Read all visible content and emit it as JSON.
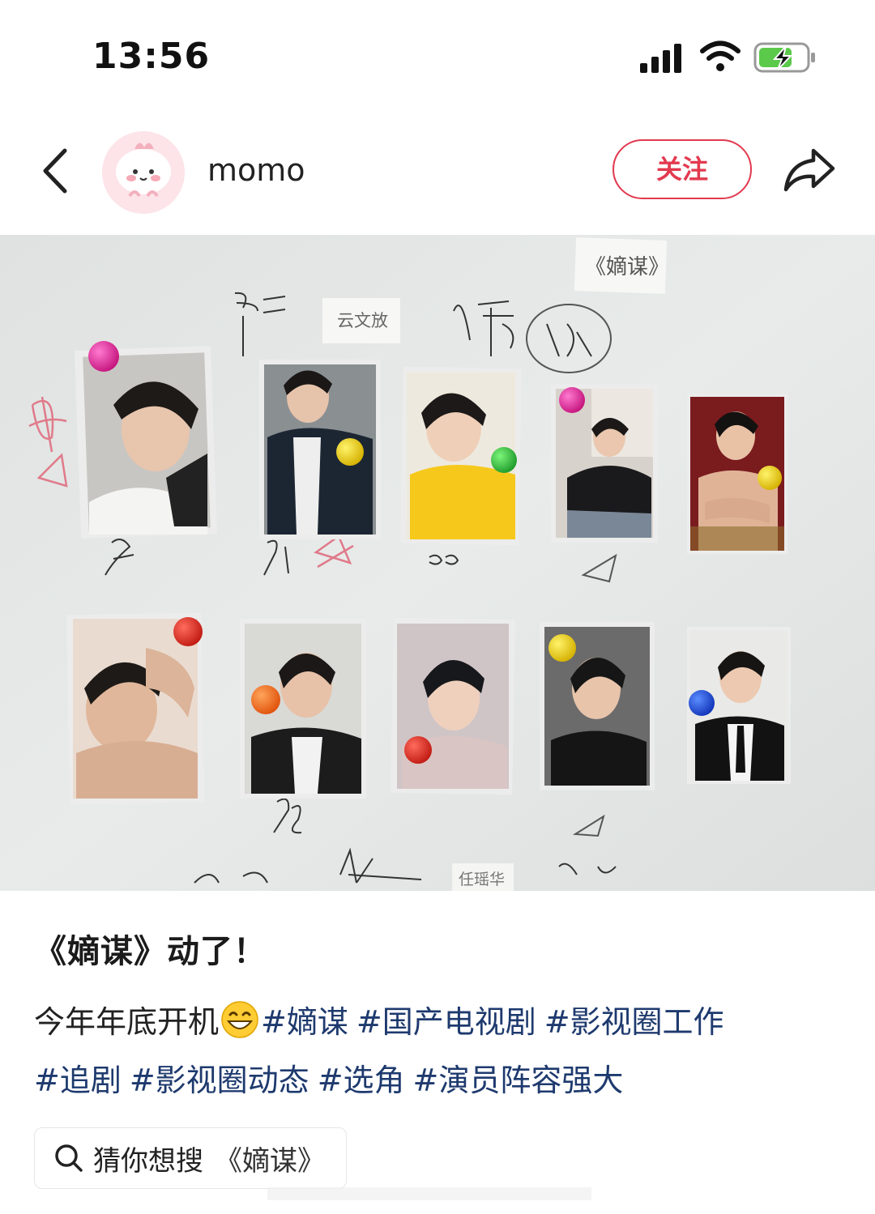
{
  "status_bar": {
    "time": "13:56"
  },
  "header": {
    "username": "momo",
    "follow_label": "关注",
    "accent_color": "#e23a4f"
  },
  "photo": {
    "notes": {
      "title_card": "《嫡谋》",
      "card_top": "云文放",
      "card_bottom": "任瑶华"
    }
  },
  "post": {
    "title": "《嫡谋》动了！",
    "intro": "今年年底开机",
    "tags": [
      "#嫡谋",
      "#国产电视剧",
      "#影视圈工作",
      "#追剧",
      "#影视圈动态",
      "#选角",
      "#演员阵容强大"
    ],
    "tag_color": "#1e3a6e"
  },
  "search": {
    "label": "猜你想搜",
    "query": "《嫡谋》"
  }
}
